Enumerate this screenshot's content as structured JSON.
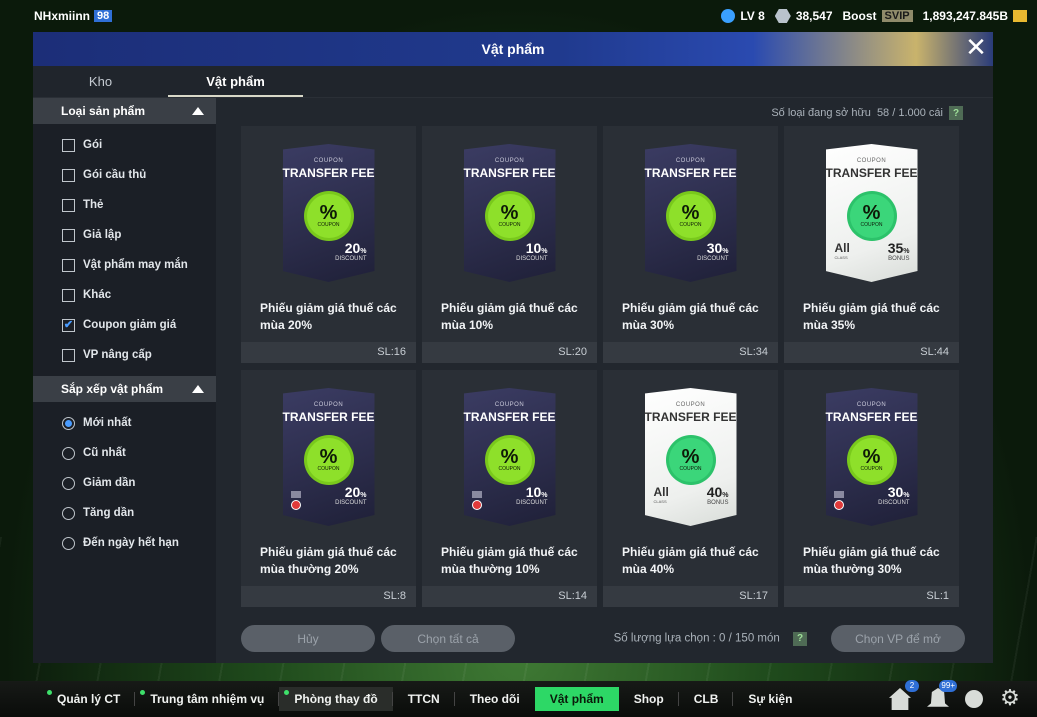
{
  "topbar": {
    "username": "NHxmiinn",
    "user_level": "98",
    "lv": "LV 8",
    "points": "38,547",
    "boost": "Boost",
    "svip": "SVIP",
    "currency": "1,893,247.845B"
  },
  "modal": {
    "title": "Vật phẩm",
    "tabs": [
      "Kho",
      "Vật phẩm"
    ],
    "active_tab": "Vật phẩm"
  },
  "sidebar": {
    "product_type_header": "Loại sản phẩm",
    "product_types": [
      {
        "label": "Gói",
        "checked": false
      },
      {
        "label": "Gói cầu thủ",
        "checked": false
      },
      {
        "label": "Thẻ",
        "checked": false
      },
      {
        "label": "Giả lập",
        "checked": false
      },
      {
        "label": "Vật phẩm may mắn",
        "checked": false
      },
      {
        "label": "Khác",
        "checked": false
      },
      {
        "label": "Coupon giảm giá",
        "checked": true
      },
      {
        "label": "VP nâng cấp",
        "checked": false
      }
    ],
    "sort_header": "Sắp xếp vật phẩm",
    "sort_options": [
      {
        "label": "Mới nhất",
        "selected": true
      },
      {
        "label": "Cũ nhất",
        "selected": false
      },
      {
        "label": "Giảm dần",
        "selected": false
      },
      {
        "label": "Tăng dần",
        "selected": false
      },
      {
        "label": "Đến ngày hết hạn",
        "selected": false
      }
    ]
  },
  "owned": {
    "label": "Số loại đang sở hữu",
    "value": "58 / 1.000 cái",
    "help": "?"
  },
  "items": [
    {
      "name": "Phiếu giảm giá thuế các mùa 20%",
      "qty": "SL:16",
      "card": {
        "style": "dark",
        "value": "20",
        "sub": "DISCOUNT",
        "marker": "none"
      }
    },
    {
      "name": "Phiếu giảm giá thuế các mùa 10%",
      "qty": "SL:20",
      "card": {
        "style": "dark",
        "value": "10",
        "sub": "DISCOUNT",
        "marker": "none"
      }
    },
    {
      "name": "Phiếu giảm giá thuế các mùa 30%",
      "qty": "SL:34",
      "card": {
        "style": "dark",
        "value": "30",
        "sub": "DISCOUNT",
        "marker": "none"
      }
    },
    {
      "name": "Phiếu giảm giá thuế các mùa 35%",
      "qty": "SL:44",
      "card": {
        "style": "white",
        "value": "35",
        "sub": "BONUS",
        "marker": "all"
      }
    },
    {
      "name": "Phiếu giảm giá thuế các mùa thường 20%",
      "qty": "SL:8",
      "card": {
        "style": "dark",
        "value": "20",
        "sub": "DISCOUNT",
        "marker": "lock"
      }
    },
    {
      "name": "Phiếu giảm giá thuế các mùa thường 10%",
      "qty": "SL:14",
      "card": {
        "style": "dark",
        "value": "10",
        "sub": "DISCOUNT",
        "marker": "lock"
      }
    },
    {
      "name": "Phiếu giảm giá thuế các mùa 40%",
      "qty": "SL:17",
      "card": {
        "style": "white",
        "value": "40",
        "sub": "BONUS",
        "marker": "all"
      }
    },
    {
      "name": "Phiếu giảm giá thuế các mùa thường 30%",
      "qty": "SL:1",
      "card": {
        "style": "dark",
        "value": "30",
        "sub": "DISCOUNT",
        "marker": "lock"
      }
    }
  ],
  "card_text": {
    "coupon": "COUPON",
    "transfer_fee": "TRANSFER FEE",
    "badge_pct": "%",
    "badge_sub": "COUPON",
    "pct_suffix": "%",
    "all": "All",
    "all_sub": "CLASS"
  },
  "actions": {
    "cancel": "Hủy",
    "select_all": "Chọn tất cả",
    "select_count": "Số lượng lựa chọn : 0 / 150 món",
    "help": "?",
    "choose_vp": "Chọn VP để mở"
  },
  "bottomnav": {
    "items": [
      {
        "label": "Quản lý CT",
        "dot": true
      },
      {
        "label": "Trung tâm nhiệm vụ",
        "dot": true
      },
      {
        "label": "Phòng thay đồ",
        "dot": true
      },
      {
        "label": "TTCN",
        "dot": false
      },
      {
        "label": "Theo dõi",
        "dot": false
      },
      {
        "label": "Vật phẩm",
        "dot": false
      },
      {
        "label": "Shop",
        "dot": false
      },
      {
        "label": "CLB",
        "dot": false
      },
      {
        "label": "Sự kiện",
        "dot": false
      }
    ],
    "active": "Vật phẩm",
    "home_badge": "2",
    "bell_badge": "99+"
  },
  "icons": [
    "close-icon",
    "home-icon",
    "bell-icon",
    "person-icon",
    "gear-icon",
    "checkbox-icon",
    "radio-icon"
  ],
  "colors": {
    "accent_green": "#2dd866",
    "check_blue": "#4a9cff",
    "badge_green": "#8ee02a"
  }
}
